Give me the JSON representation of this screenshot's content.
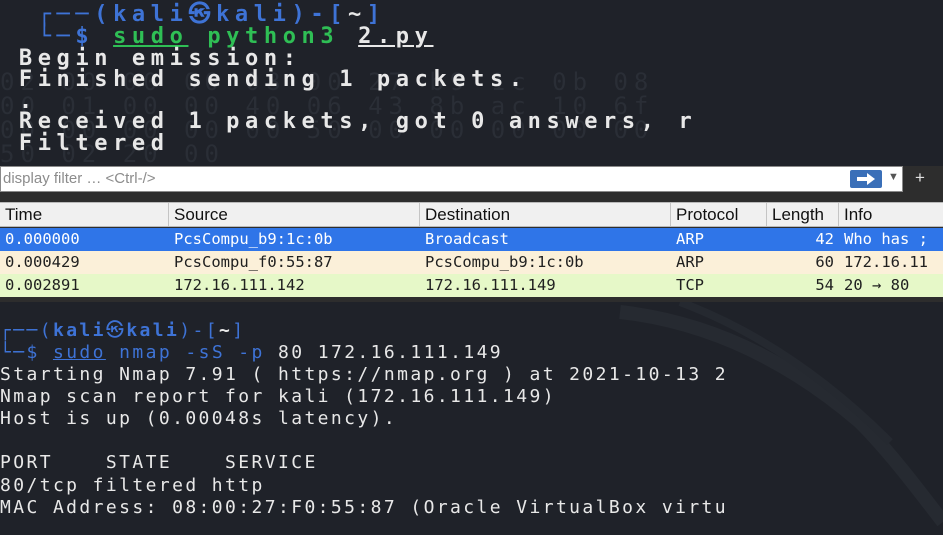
{
  "terminal_top": {
    "prompt_user": "kali",
    "prompt_host": "kali",
    "prompt_dir": "~",
    "cmd_sudo": "sudo",
    "cmd_prog": "python3",
    "cmd_arg": "2.py",
    "out1": "Begin emission:",
    "out2": "Finished sending 1 packets.",
    "out3": ".",
    "out4": "Received 1 packets, got 0 answers, r",
    "out5": "Filtered"
  },
  "wireshark": {
    "filter_placeholder": "display filter … <Ctrl-/>",
    "columns": [
      "Time",
      "Source",
      "Destination",
      "Protocol",
      "Length",
      "Info"
    ],
    "packets": [
      {
        "time": "0.000000",
        "source": "PcsCompu_b9:1c:0b",
        "destination": "Broadcast",
        "protocol": "ARP",
        "length": "42",
        "info": "Who has ;"
      },
      {
        "time": "0.000429",
        "source": "PcsCompu_f0:55:87",
        "destination": "PcsCompu_b9:1c:0b",
        "protocol": "ARP",
        "length": "60",
        "info": "172.16.11"
      },
      {
        "time": "0.002891",
        "source": "172.16.111.142",
        "destination": "172.16.111.149",
        "protocol": "TCP",
        "length": "54",
        "info": "20 → 80"
      }
    ],
    "colors": {
      "selected": "#2f75e8",
      "arp": "#fbf0d9",
      "tcp": "#e6f8c8"
    }
  },
  "terminal_bottom": {
    "prompt_user": "kali",
    "prompt_host": "kali",
    "prompt_dir": "~",
    "cmd_sudo": "sudo",
    "cmd_rest": "nmap -sS -p",
    "cmd_args": "80 172.16.111.149",
    "out1": "Starting Nmap 7.91 ( https://nmap.org ) at 2021-10-13 2",
    "out2": "Nmap scan report for kali (172.16.111.149)",
    "out3": "Host is up (0.00048s latency).",
    "out4": "",
    "out5": "PORT    STATE    SERVICE",
    "out6": "80/tcp filtered http",
    "out7": "MAC Address: 08:00:27:F0:55:87 (Oracle VirtualBox virtu"
  }
}
